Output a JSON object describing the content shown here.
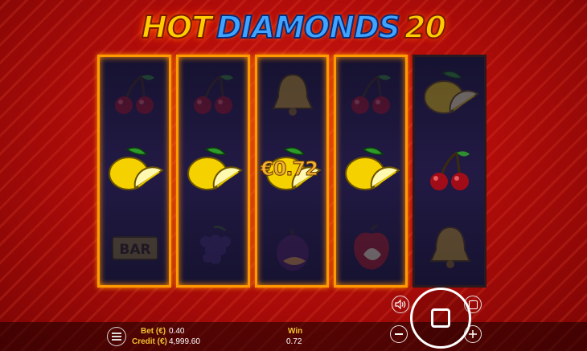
{
  "game": {
    "title_part1": "HOT",
    "title_part2": "DIAMONDS",
    "title_part3": "20",
    "win_overlay": "€0.72"
  },
  "reels": [
    [
      "cherry",
      "lemon",
      "bar"
    ],
    [
      "cherry",
      "lemon",
      "grapes"
    ],
    [
      "bell",
      "lemon",
      "plum"
    ],
    [
      "cherry",
      "lemon",
      "apple"
    ],
    [
      "lemon",
      "cherry",
      "bell"
    ]
  ],
  "bar_symbol_text": "BAR",
  "winning_row": 1,
  "hud": {
    "bet_label": "Bet (€)",
    "bet_value": "0.40",
    "credit_label": "Credit (€)",
    "credit_value": "4,999.60",
    "win_label": "Win",
    "win_value": "0.72"
  },
  "colors": {
    "accent": "#ff9a00",
    "label": "#f2c230",
    "background": "#c8130f"
  }
}
